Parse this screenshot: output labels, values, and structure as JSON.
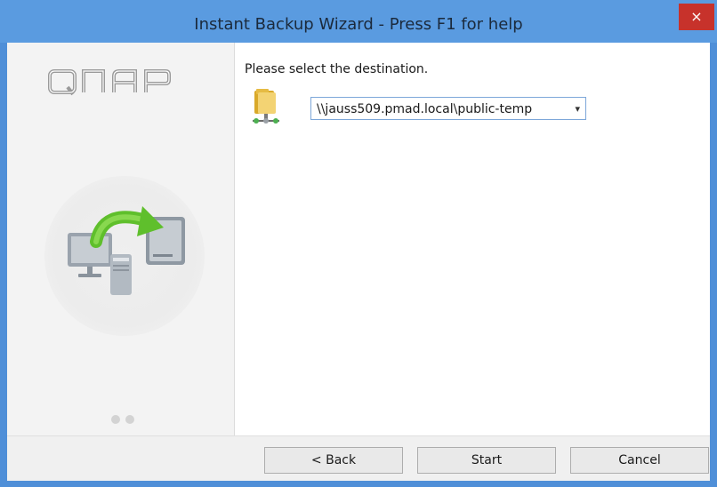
{
  "window": {
    "title": "Instant Backup Wizard - Press F1 for help",
    "close_glyph": "×"
  },
  "brand": {
    "logo_text": "QNAP"
  },
  "main": {
    "prompt": "Please select the destination.",
    "destination": {
      "selected_value": "\\\\jauss509.pmad.local\\public-temp",
      "dropdown_arrow": "▾"
    }
  },
  "sidebar": {
    "pager": {
      "total": 2,
      "current": 1
    }
  },
  "footer": {
    "back_label": "< Back",
    "start_label": "Start",
    "cancel_label": "Cancel"
  },
  "colors": {
    "titlebar": "#5a9be0",
    "close_button": "#c7322b",
    "accent_green": "#6ac234"
  }
}
